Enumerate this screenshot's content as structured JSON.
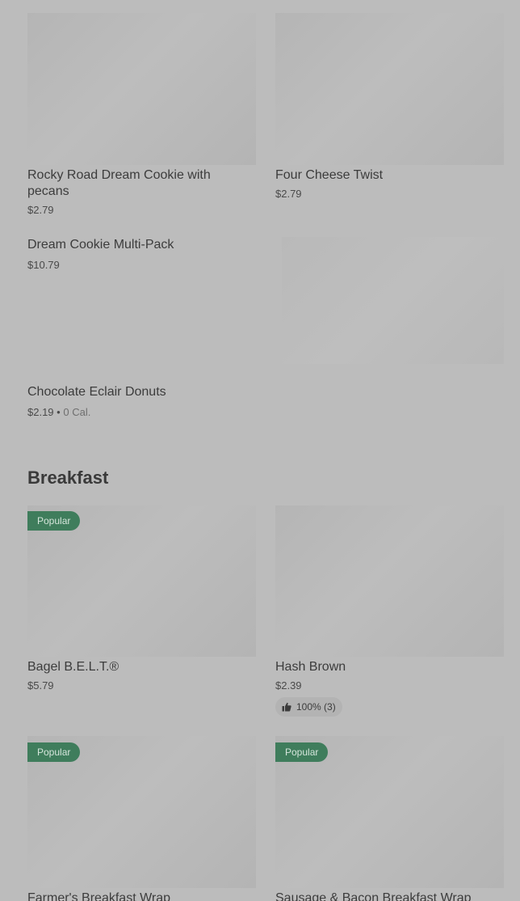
{
  "items": {
    "rocky_road": {
      "title": "Rocky Road Dream Cookie with pecans",
      "price": "$2.79"
    },
    "four_cheese": {
      "title": "Four Cheese Twist",
      "price": "$2.79"
    },
    "multipack": {
      "title": "Dream Cookie Multi-Pack",
      "price": "$10.79"
    },
    "eclair": {
      "title": "Chocolate Eclair Donuts",
      "price": "$2.19",
      "separator": "•",
      "calories": "0 Cal."
    },
    "bagel": {
      "title": "Bagel B.E.L.T.®",
      "price": "$5.79",
      "badge": "Popular"
    },
    "hash_brown": {
      "title": "Hash Brown",
      "price": "$2.39",
      "rating": "100% (3)"
    },
    "farmer": {
      "title": "Farmer's Breakfast Wrap",
      "badge": "Popular"
    },
    "sausage": {
      "title": "Sausage & Bacon Breakfast Wrap",
      "badge": "Popular"
    }
  },
  "sections": {
    "breakfast": "Breakfast"
  },
  "icons": {
    "rating": "thumbs-up-icon"
  },
  "colors": {
    "badge": "#3f7d5c",
    "background": "#bcbcbc"
  }
}
